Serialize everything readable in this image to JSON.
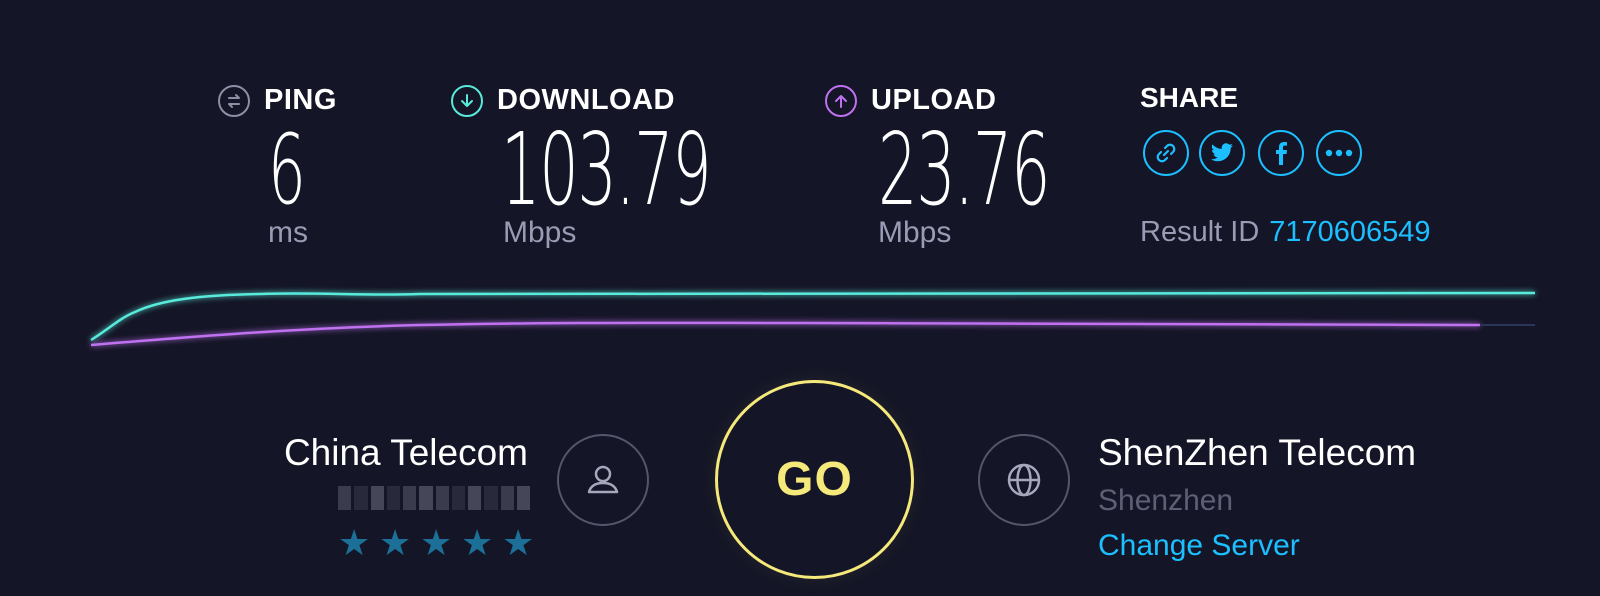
{
  "ping": {
    "label": "PING",
    "value": "6",
    "unit": "ms",
    "icon": "ping-icon",
    "color": "#9a9bb4"
  },
  "download": {
    "label": "DOWNLOAD",
    "value": "103.79",
    "unit": "Mbps",
    "icon": "download-arrow-icon",
    "color": "#59eadb"
  },
  "upload": {
    "label": "UPLOAD",
    "value": "23.76",
    "unit": "Mbps",
    "icon": "upload-arrow-icon",
    "color": "#bf71f0"
  },
  "share": {
    "label": "SHARE",
    "buttons": [
      "link-icon",
      "twitter-icon",
      "facebook-icon",
      "more-icon"
    ],
    "color": "#1cbfff"
  },
  "result": {
    "label": "Result ID",
    "id": "7170606549"
  },
  "isp": {
    "name": "China Telecom",
    "rating_stars": 5,
    "icon": "user-icon"
  },
  "go_button": {
    "label": "GO",
    "color": "#f5e97c"
  },
  "server": {
    "name": "ShenZhen Telecom",
    "city": "Shenzhen",
    "change_label": "Change Server",
    "icon": "globe-icon"
  },
  "colors": {
    "background": "#141526",
    "accent": "#1cbfff"
  }
}
